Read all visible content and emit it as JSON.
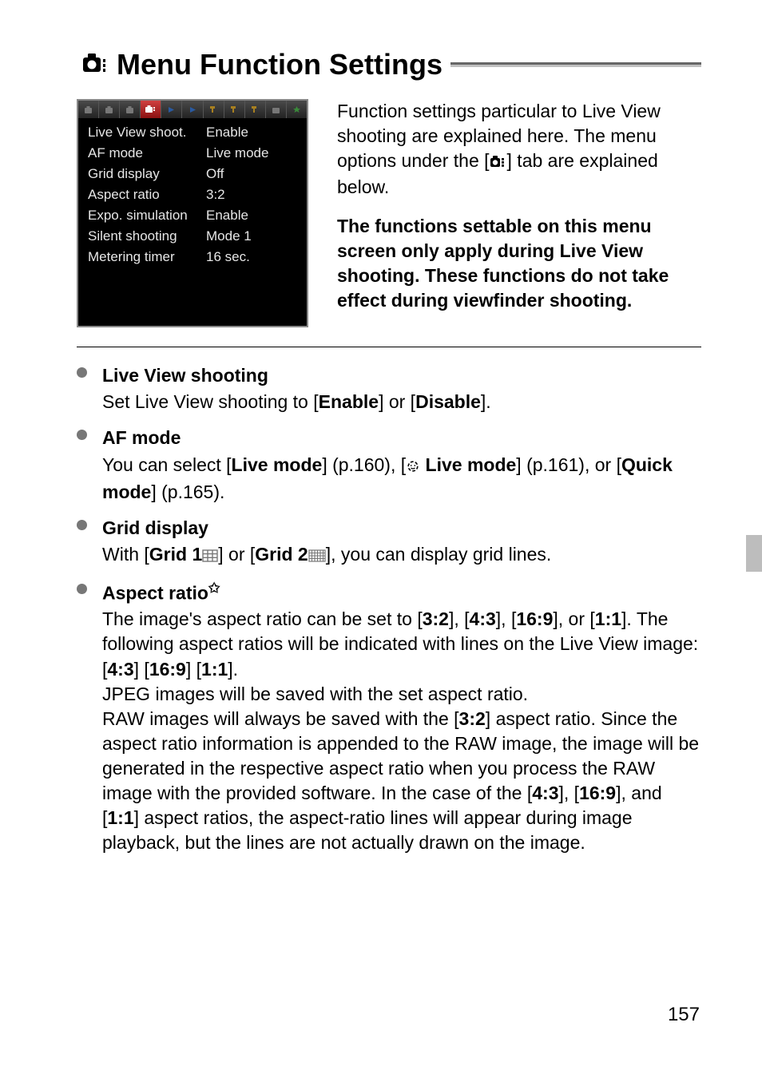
{
  "title": {
    "text": "Menu Function Settings",
    "icon": "camera-menu-icon"
  },
  "menu_shot": {
    "tabs": [
      {
        "icon": "cam-tab",
        "active": false
      },
      {
        "icon": "cam-tab",
        "active": false
      },
      {
        "icon": "cam-tab",
        "active": false
      },
      {
        "icon": "cam-lv-tab",
        "active": true
      },
      {
        "icon": "play-tab",
        "active": false
      },
      {
        "icon": "play-tab",
        "active": false
      },
      {
        "icon": "wrench-tab",
        "active": false
      },
      {
        "icon": "wrench-tab",
        "active": false
      },
      {
        "icon": "wrench-tab",
        "active": false
      },
      {
        "icon": "custom-tab",
        "active": false
      },
      {
        "icon": "star-tab",
        "active": false
      }
    ],
    "rows": [
      {
        "label": "Live View shoot.",
        "value": "Enable"
      },
      {
        "label": "AF mode",
        "value": "Live mode"
      },
      {
        "label": "Grid display",
        "value": "Off"
      },
      {
        "label": "Aspect ratio",
        "value": "3:2"
      },
      {
        "label": "Expo. simulation",
        "value": "Enable"
      },
      {
        "label": "Silent shooting",
        "value": "Mode 1"
      },
      {
        "label": "Metering timer",
        "value": "16 sec."
      }
    ]
  },
  "intro": {
    "p1_a": "Function settings particular to Live View shooting are explained here. The menu options under the [",
    "p1_b": "] tab are explained below.",
    "p2": "The functions settable on this menu screen only apply during Live View shooting. These functions do not take effect during viewfinder shooting."
  },
  "bullets": {
    "b1": {
      "title": "Live View shooting",
      "body_pre": "Set Live View shooting to [",
      "body_mid": "] or [",
      "body_post": "].",
      "v1": "Enable",
      "v2": "Disable"
    },
    "b2": {
      "title": "AF mode",
      "pre": "You can select [",
      "v1": "Live mode",
      "pageref1": "] (p.160), [",
      "v2": " Live mode",
      "pageref2": "] (p.161), or [",
      "v3": "Quick mode",
      "post": "] (p.165)."
    },
    "b3": {
      "title": "Grid display",
      "pre": "With [",
      "v1": "Grid 1",
      "mid": "] or [",
      "v2": "Grid 2",
      "post": "], you can display grid lines."
    },
    "b4": {
      "title": "Aspect ratio",
      "star": "★",
      "l1_pre": "The image's aspect ratio can be set to [",
      "r1": "3:2",
      "s1": "], [",
      "r2": "4:3",
      "s2": "], [",
      "r3": "16:9",
      "s3": "], or [",
      "r4": "1:1",
      "s4": "]. ",
      "l2_pre": "The following aspect ratios will be indicated with lines on the Live View image: [",
      "r5": "4:3",
      "s5": "] [",
      "r6": "16:9",
      "s6": "] [",
      "r7": "1:1",
      "s7": "].",
      "l3": "JPEG images will be saved with the set aspect ratio.",
      "l4_pre": "RAW images will always be saved with the [",
      "r8": "3:2",
      "l4_mid": "] aspect ratio. Since the aspect ratio information is appended to the RAW image, the image will be generated in the respective aspect ratio when you process the RAW image with the provided software. In the case of the [",
      "r9": "4:3",
      "s9": "], [",
      "r10": "16:9",
      "s10": "], and [",
      "r11": "1:1",
      "l4_post": "] aspect ratios, the aspect-ratio lines will appear during image playback, but the lines are not actually drawn on the image."
    }
  },
  "page_number": "157"
}
